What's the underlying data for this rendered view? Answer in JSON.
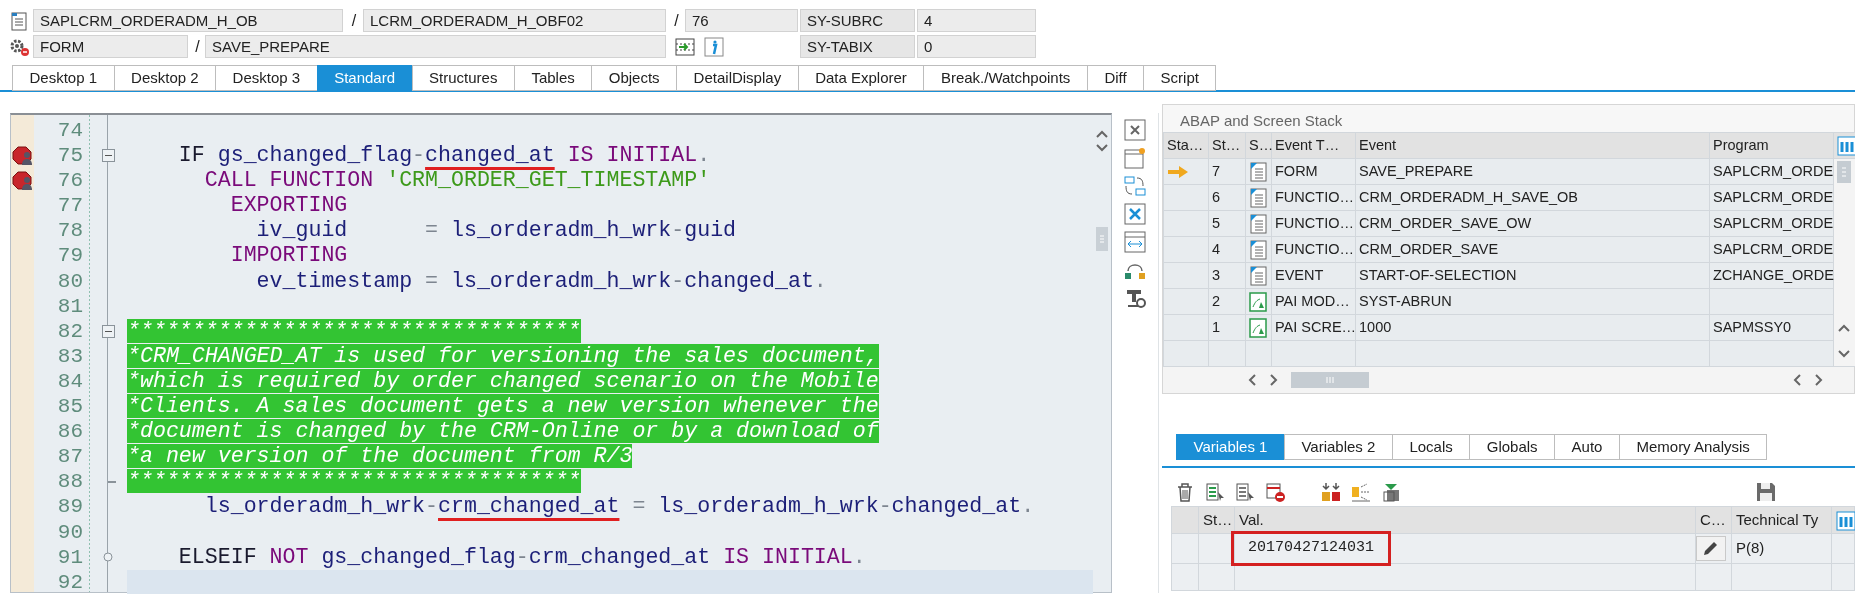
{
  "header": {
    "rows": [
      {
        "items": [
          {
            "kind": "field",
            "text": "SAPLCRM_ORDERADM_H_OB"
          },
          {
            "kind": "separator",
            "text": "/"
          },
          {
            "kind": "field",
            "text": "LCRM_ORDERADM_H_OBF02"
          },
          {
            "kind": "separator",
            "text": "/"
          },
          {
            "kind": "field",
            "text": "76"
          },
          {
            "kind": "system",
            "text": "SY-SUBRC"
          },
          {
            "kind": "field",
            "text": "4"
          }
        ]
      },
      {
        "items": [
          {
            "kind": "field",
            "text": "FORM"
          },
          {
            "kind": "separator",
            "text": "/"
          },
          {
            "kind": "field",
            "text": "SAVE_PREPARE"
          },
          {
            "kind": "system",
            "text": "SY-TABIX"
          },
          {
            "kind": "field",
            "text": "0"
          }
        ]
      }
    ]
  },
  "top_tabs": [
    {
      "label": "Desktop 1",
      "selected": false
    },
    {
      "label": "Desktop 2",
      "selected": false
    },
    {
      "label": "Desktop 3",
      "selected": false
    },
    {
      "label": "Standard",
      "selected": true
    },
    {
      "label": "Structures",
      "selected": false
    },
    {
      "label": "Tables",
      "selected": false
    },
    {
      "label": "Objects",
      "selected": false
    },
    {
      "label": "DetailDisplay",
      "selected": false
    },
    {
      "label": "Data Explorer",
      "selected": false
    },
    {
      "label": "Break./Watchpoints",
      "selected": false
    },
    {
      "label": "Diff",
      "selected": false
    },
    {
      "label": "Script",
      "selected": false
    }
  ],
  "code": {
    "lines": [
      {
        "number": "74",
        "breakpoint": false,
        "current": false
      },
      {
        "number": "75",
        "breakpoint": true,
        "current": false,
        "fold": {
          "kind": "start"
        },
        "segments": [
          {
            "kind": "control",
            "text": "    IF ",
            "underlined": false
          },
          {
            "kind": "ident",
            "text": "gs_changed_flag",
            "underlined": false
          },
          {
            "kind": "op",
            "text": "-",
            "underlined": false
          },
          {
            "kind": "ident",
            "text": "changed_at",
            "underlined": true
          },
          {
            "kind": "keyword",
            "text": " IS INITIAL",
            "underlined": false
          },
          {
            "kind": "op",
            "text": ".",
            "underlined": false
          }
        ]
      },
      {
        "number": "76",
        "breakpoint": true,
        "current": false,
        "segments": [
          {
            "kind": "keyword",
            "text": "      CALL FUNCTION ",
            "underlined": false
          },
          {
            "kind": "string",
            "text": "'CRM_ORDER_GET_TIMESTAMP'",
            "underlined": false
          }
        ]
      },
      {
        "number": "77",
        "breakpoint": false,
        "current": false,
        "segments": [
          {
            "kind": "keyword",
            "text": "        EXPORTING",
            "underlined": false
          }
        ]
      },
      {
        "number": "78",
        "breakpoint": false,
        "current": false,
        "segments": [
          {
            "kind": "ident",
            "text": "          iv_guid",
            "underlined": false
          },
          {
            "kind": "op",
            "text": "      = ",
            "underlined": false
          },
          {
            "kind": "ident",
            "text": "ls_orderadm_h_wrk",
            "underlined": false
          },
          {
            "kind": "op",
            "text": "-",
            "underlined": false
          },
          {
            "kind": "ident",
            "text": "guid",
            "underlined": false
          }
        ]
      },
      {
        "number": "79",
        "breakpoint": false,
        "current": false,
        "segments": [
          {
            "kind": "keyword",
            "text": "        IMPORTING",
            "underlined": false
          }
        ]
      },
      {
        "number": "80",
        "breakpoint": false,
        "current": false,
        "segments": [
          {
            "kind": "ident",
            "text": "          ev_timestamp",
            "underlined": false
          },
          {
            "kind": "op",
            "text": " = ",
            "underlined": false
          },
          {
            "kind": "ident",
            "text": "ls_orderadm_h_wrk",
            "underlined": false
          },
          {
            "kind": "op",
            "text": "-",
            "underlined": false
          },
          {
            "kind": "ident",
            "text": "changed_at",
            "underlined": false
          },
          {
            "kind": "op",
            "text": ".",
            "underlined": false
          }
        ]
      },
      {
        "number": "81",
        "breakpoint": false,
        "current": false
      },
      {
        "number": "82",
        "breakpoint": false,
        "current": false,
        "fold": {
          "kind": "start"
        },
        "segments": [
          {
            "kind": "comment",
            "text": "***********************************",
            "underlined": false
          }
        ]
      },
      {
        "number": "83",
        "breakpoint": false,
        "current": false,
        "segments": [
          {
            "kind": "comment",
            "text": "*CRM_CHANGED_AT is used for versioning the sales document,",
            "underlined": false
          }
        ]
      },
      {
        "number": "84",
        "breakpoint": false,
        "current": false,
        "segments": [
          {
            "kind": "comment",
            "text": "*which is required by order changed scenario on the Mobile",
            "underlined": false
          }
        ]
      },
      {
        "number": "85",
        "breakpoint": false,
        "current": false,
        "segments": [
          {
            "kind": "comment",
            "text": "*Clients. A sales document gets a new version whenever the",
            "underlined": false
          }
        ]
      },
      {
        "number": "86",
        "breakpoint": false,
        "current": false,
        "segments": [
          {
            "kind": "comment",
            "text": "*document is changed by the CRM-Online or by a download of",
            "underlined": false
          }
        ]
      },
      {
        "number": "87",
        "breakpoint": false,
        "current": false,
        "segments": [
          {
            "kind": "comment",
            "text": "*a new version of the document from R/3",
            "underlined": false
          }
        ]
      },
      {
        "number": "88",
        "breakpoint": false,
        "current": false,
        "fold": {
          "kind": "end"
        },
        "segments": [
          {
            "kind": "comment",
            "text": "***********************************",
            "underlined": false
          }
        ]
      },
      {
        "number": "89",
        "breakpoint": false,
        "current": false,
        "segments": [
          {
            "kind": "ident",
            "text": "      ls_orderadm_h_wrk",
            "underlined": false
          },
          {
            "kind": "op",
            "text": "-",
            "underlined": false
          },
          {
            "kind": "ident",
            "text": "crm_changed_at",
            "underlined": true
          },
          {
            "kind": "op",
            "text": " = ",
            "underlined": false
          },
          {
            "kind": "ident",
            "text": "ls_orderadm_h_wrk",
            "underlined": false
          },
          {
            "kind": "op",
            "text": "-",
            "underlined": false
          },
          {
            "kind": "ident",
            "text": "changed_at",
            "underlined": false
          },
          {
            "kind": "op",
            "text": ".",
            "underlined": false
          }
        ]
      },
      {
        "number": "90",
        "breakpoint": false,
        "current": false
      },
      {
        "number": "91",
        "breakpoint": false,
        "current": false,
        "fold": {
          "kind": "branch"
        },
        "segments": [
          {
            "kind": "control",
            "text": "    ELSEIF ",
            "underlined": false
          },
          {
            "kind": "keyword",
            "text": "NOT ",
            "underlined": false
          },
          {
            "kind": "ident",
            "text": "gs_changed_flag",
            "underlined": false
          },
          {
            "kind": "op",
            "text": "-",
            "underlined": false
          },
          {
            "kind": "ident",
            "text": "crm_changed_at",
            "underlined": false
          },
          {
            "kind": "keyword",
            "text": " IS INITIAL",
            "underlined": false
          },
          {
            "kind": "op",
            "text": ".",
            "underlined": false
          }
        ]
      },
      {
        "number": "92",
        "breakpoint": false,
        "current": true
      }
    ]
  },
  "stack": {
    "title": "ABAP and Screen Stack",
    "columns": [
      "Sta…",
      "St…",
      "S…",
      "Event T…",
      "Event",
      "Program"
    ],
    "rows": [
      {
        "current": true,
        "number": "7",
        "kind": "abap",
        "event_type": "FORM",
        "event": "SAVE_PREPARE",
        "program": "SAPLCRM_ORDE"
      },
      {
        "current": false,
        "number": "6",
        "kind": "abap",
        "event_type": "FUNCTIO…",
        "event": "CRM_ORDERADM_H_SAVE_OB",
        "program": "SAPLCRM_ORDE"
      },
      {
        "current": false,
        "number": "5",
        "kind": "abap",
        "event_type": "FUNCTIO…",
        "event": "CRM_ORDER_SAVE_OW",
        "program": "SAPLCRM_ORDE"
      },
      {
        "current": false,
        "number": "4",
        "kind": "abap",
        "event_type": "FUNCTIO…",
        "event": "CRM_ORDER_SAVE",
        "program": "SAPLCRM_ORDE"
      },
      {
        "current": false,
        "number": "3",
        "kind": "abap",
        "event_type": "EVENT",
        "event": "START-OF-SELECTION",
        "program": "ZCHANGE_ORDE"
      },
      {
        "current": false,
        "number": "2",
        "kind": "screen",
        "event_type": "PAI MOD…",
        "event": "SYST-ABRUN"
      },
      {
        "current": false,
        "number": "1",
        "kind": "screen",
        "event_type": "PAI SCRE…",
        "event": "1000",
        "program": "SAPMSSY0"
      }
    ]
  },
  "variables": {
    "tabs": [
      {
        "label": "Variables 1",
        "selected": true
      },
      {
        "label": "Variables 2",
        "selected": false
      },
      {
        "label": "Locals",
        "selected": false
      },
      {
        "label": "Globals",
        "selected": false
      },
      {
        "label": "Auto",
        "selected": false
      },
      {
        "label": "Memory Analysis",
        "selected": false
      }
    ],
    "columns": [
      "St…",
      "Val.",
      "C…",
      "Technical Ty"
    ],
    "rows": [
      {
        "value": "20170427124031",
        "highlighted": true,
        "editable": true,
        "technical_type": "P(8)"
      }
    ]
  }
}
